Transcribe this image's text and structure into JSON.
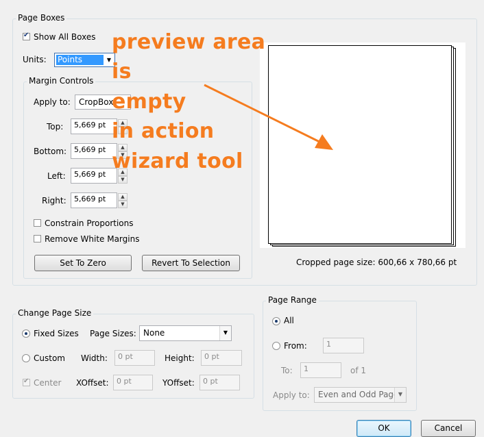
{
  "page_boxes": {
    "legend": "Page Boxes",
    "show_all_boxes": "Show All Boxes",
    "units_label": "Units:",
    "units_value": "Points",
    "margin_controls": {
      "legend": "Margin Controls",
      "apply_to_label": "Apply to:",
      "apply_to_value": "CropBox",
      "top_label": "Top:",
      "top_value": "5,669 pt",
      "bottom_label": "Bottom:",
      "bottom_value": "5,669 pt",
      "left_label": "Left:",
      "left_value": "5,669 pt",
      "right_label": "Right:",
      "right_value": "5,669 pt",
      "constrain": "Constrain Proportions",
      "remove_white": "Remove White Margins",
      "set_to_zero": "Set To Zero",
      "revert": "Revert To Selection"
    },
    "cropped_size": "Cropped page size: 600,66 x 780,66 pt"
  },
  "change_page_size": {
    "legend": "Change Page Size",
    "fixed_sizes": "Fixed Sizes",
    "page_sizes_label": "Page Sizes:",
    "page_sizes_value": "None",
    "custom": "Custom",
    "width_label": "Width:",
    "width_value": "0 pt",
    "height_label": "Height:",
    "height_value": "0 pt",
    "center": "Center",
    "xoffset_label": "XOffset:",
    "xoffset_value": "0 pt",
    "yoffset_label": "YOffset:",
    "yoffset_value": "0 pt"
  },
  "page_range": {
    "legend": "Page Range",
    "all": "All",
    "from": "From:",
    "from_value": "1",
    "to": "To:",
    "to_value": "1",
    "of": "of 1",
    "apply_to_label": "Apply to:",
    "apply_to_value": "Even and Odd Pages"
  },
  "buttons": {
    "ok": "OK",
    "cancel": "Cancel"
  },
  "annotation": {
    "lines": [
      "preview area",
      "is",
      "empty",
      "in action",
      "wizard tool"
    ],
    "color": "#f57c1f"
  }
}
